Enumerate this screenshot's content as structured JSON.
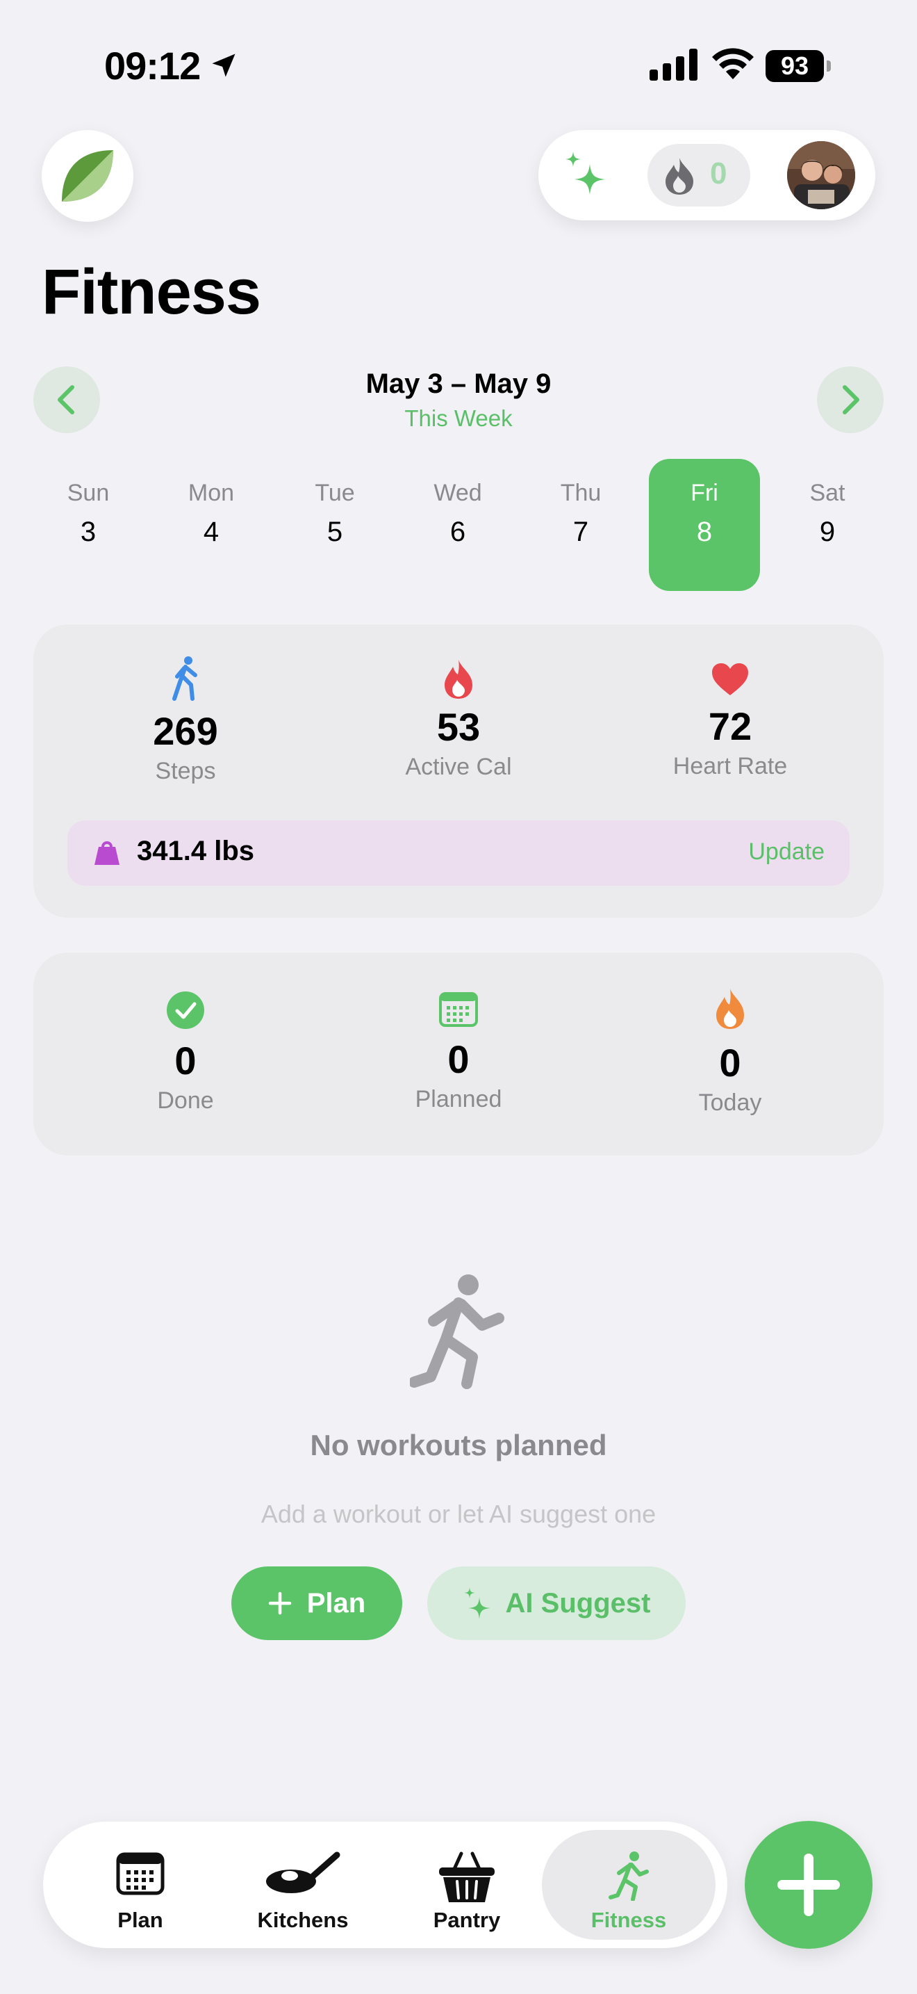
{
  "status_bar": {
    "time": "09:12",
    "battery": "93"
  },
  "header": {
    "streak_count": "0"
  },
  "page": {
    "title": "Fitness"
  },
  "week": {
    "range": "May 3 – May 9",
    "subtitle": "This Week",
    "days": [
      {
        "name": "Sun",
        "num": "3"
      },
      {
        "name": "Mon",
        "num": "4"
      },
      {
        "name": "Tue",
        "num": "5"
      },
      {
        "name": "Wed",
        "num": "6"
      },
      {
        "name": "Thu",
        "num": "7"
      },
      {
        "name": "Fri",
        "num": "8",
        "selected": true
      },
      {
        "name": "Sat",
        "num": "9"
      }
    ]
  },
  "health": {
    "steps": {
      "value": "269",
      "label": "Steps",
      "icon": "walking-icon"
    },
    "active_cal": {
      "value": "53",
      "label": "Active Cal",
      "icon": "flame-icon"
    },
    "heart_rate": {
      "value": "72",
      "label": "Heart Rate",
      "icon": "heart-icon"
    },
    "weight": {
      "value": "341.4 lbs",
      "action": "Update",
      "icon": "weight-icon"
    }
  },
  "workouts": {
    "done": {
      "value": "0",
      "label": "Done"
    },
    "planned": {
      "value": "0",
      "label": "Planned"
    },
    "today": {
      "value": "0",
      "label": "Today"
    }
  },
  "empty_state": {
    "title": "No workouts planned",
    "subtitle": "Add a workout or let AI suggest one",
    "plan_label": "Plan",
    "ai_label": "AI Suggest"
  },
  "tabs": [
    {
      "label": "Plan",
      "icon": "calendar-icon"
    },
    {
      "label": "Kitchens",
      "icon": "pan-icon"
    },
    {
      "label": "Pantry",
      "icon": "basket-icon"
    },
    {
      "label": "Fitness",
      "icon": "runner-icon",
      "active": true
    }
  ],
  "colors": {
    "accent": "#5cc468",
    "card": "#ebebed",
    "background": "#f2f2f6",
    "weight_row": "#ecdeee"
  }
}
